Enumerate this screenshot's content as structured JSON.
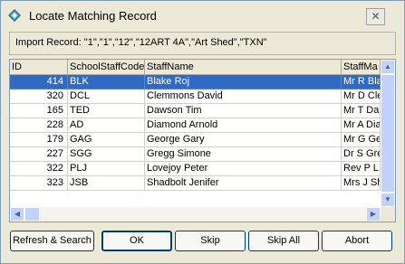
{
  "window": {
    "title": "Locate Matching Record",
    "close_glyph": "✕",
    "icon": "diamond-app-icon"
  },
  "import_record": {
    "label": "Import Record: \"1\",\"1\",\"12\",\"12ART 4A\",\"Art Shed\",\"TXN\""
  },
  "grid": {
    "columns": [
      "ID",
      "SchoolStaffCode",
      "StaffName",
      "StaffMa"
    ],
    "rows": [
      [
        "414",
        "BLK",
        "Blake Roj",
        "Mr R Bla"
      ],
      [
        "320",
        "DCL",
        "Clemmons David",
        "Mr D Cle"
      ],
      [
        "165",
        "TED",
        "Dawson Tim",
        "Mr T Da"
      ],
      [
        "228",
        "AD",
        "Diamond Arnold",
        "Mr A Dia"
      ],
      [
        "179",
        "GAG",
        "George Gary",
        "Mr G Ge"
      ],
      [
        "227",
        "SGG",
        "Gregg Simone",
        "Dr S Gre"
      ],
      [
        "322",
        "PLJ",
        "Lovejoy Peter",
        "Rev P L"
      ],
      [
        "323",
        "JSB",
        "Shadbolt Jenifer",
        "Mrs J Sh"
      ]
    ],
    "selected_row": 0,
    "selected_color": "#316ac5"
  },
  "buttons": {
    "refresh_search": "Refresh & Search",
    "ok": "OK",
    "skip": "Skip",
    "skip_all": "Skip All",
    "abort": "Abort"
  },
  "scroll": {
    "up": "▲",
    "down": "▼",
    "left": "◀",
    "right": "▶"
  }
}
